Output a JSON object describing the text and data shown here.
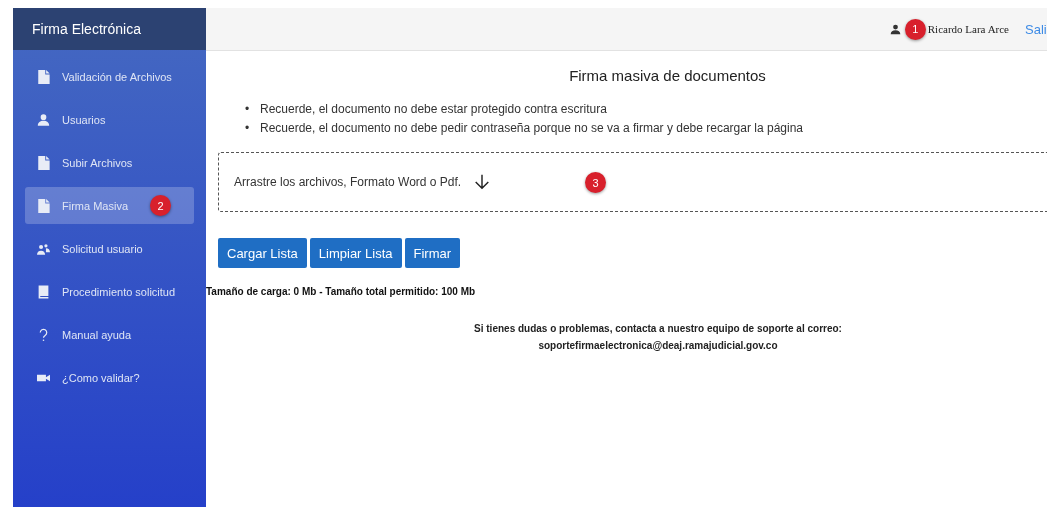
{
  "sidebar": {
    "brand": "Firma Electrónica",
    "items": [
      {
        "label": "Validación de Archivos",
        "kind": "file",
        "selected": false
      },
      {
        "label": "Usuarios",
        "kind": "user",
        "selected": false
      },
      {
        "label": "Subir Archivos",
        "kind": "file",
        "selected": false
      },
      {
        "label": "Firma Masiva",
        "kind": "file",
        "selected": true,
        "badge": "2"
      },
      {
        "label": "Solicitud usuario",
        "kind": "users",
        "selected": false
      },
      {
        "label": "Procedimiento solicitud",
        "kind": "book",
        "selected": false
      },
      {
        "label": "Manual ayuda",
        "kind": "question",
        "selected": false
      },
      {
        "label": "¿Como validar?",
        "kind": "video",
        "selected": false
      }
    ]
  },
  "header": {
    "user": "Ricardo Lara Arce",
    "badge": "1",
    "logout": "Sali"
  },
  "title": "Firma masiva de documentos",
  "notes": [
    {
      "bullet": "•",
      "text": "Recuerde, el documento no debe estar protegido contra escritura"
    },
    {
      "bullet": "•",
      "text": "Recuerde, el documento no debe pedir contraseña porque no se va a firmar y debe recargar la página"
    }
  ],
  "dropzone": {
    "text": "Arrastre los archivos, Formato Word o Pdf.",
    "badge": "3"
  },
  "buttons": [
    "Cargar Lista",
    "Limpiar Lista",
    "Firmar"
  ],
  "size_info": "**Tamaño de carga:** 0 Mb - **Tamaño total permitido:** 100 Mb",
  "support": [
    "Si tienes dudas o problemas, contacta a nuestro equipo de soporte al correo:",
    "soportefirmaelectronica@deaj.ramajudicial.gov.co"
  ]
}
